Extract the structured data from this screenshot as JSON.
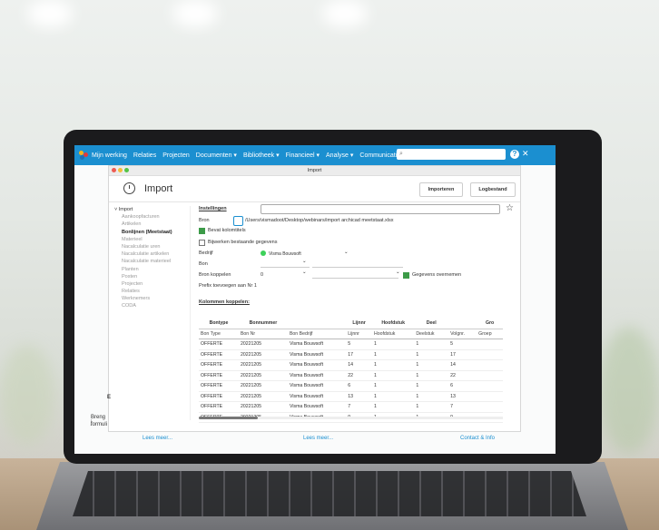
{
  "nav": {
    "items": [
      "Mijn werking",
      "Relaties",
      "Projecten",
      "Documenten ▾",
      "Bibliotheek ▾",
      "Financieel ▾",
      "Analyse ▾",
      "Communicatie ▾"
    ],
    "search_placeholder": "",
    "help": "?"
  },
  "window": {
    "title": "Import",
    "page_title": "Import",
    "import_button": "Importeren",
    "log_button": "Logbestand"
  },
  "sidebar": {
    "group": "Import",
    "items": [
      "Aankoopfacturen",
      "Artikelen",
      "Bonlijnen (Meetstaat)",
      "Materieel",
      "Nacalculatie uren",
      "Nacalculatie artikelen",
      "Nacalculatie materieel",
      "Planten",
      "Posten",
      "Projecten",
      "Relaties",
      "Werknemers",
      "CODA"
    ],
    "selected": "Bonlijnen (Meetstaat)"
  },
  "settings": {
    "heading": "Instellingen",
    "bron_label": "Bron",
    "bron_value": "/Users/vismadoot/Desktop/webinars/import archicad meetstaat.xlsx",
    "bevat_kolomtitels": "Bevat kolomtitels",
    "bijwerken": "Bijwerken bestaande gegevens",
    "bedrijf_label": "Bedrijf",
    "bedrijf_value": "Visma Bouwsoft",
    "bon_label": "Bon",
    "bron_koppelen_label": "Bron koppelen",
    "bron_koppelen_value": "0",
    "gegevens_overnemen": "Gegevens overnemen",
    "prefix": "Prefix toevoegen aan Nr 1",
    "kolommen": "Kolommen koppelen:"
  },
  "table": {
    "headers": [
      "Bontype",
      "Bonnummer",
      "",
      "Lijnnr",
      "Hoofdstuk",
      "Deel",
      "",
      "Gro"
    ],
    "subheaders": [
      "Bon Type",
      "Bon Nr",
      "Bon Bedrijf",
      "Lijnnr",
      "Hoofdstuk",
      "Deelstuk",
      "Volgnr.",
      "Groep"
    ],
    "rows": [
      [
        "OFFERTE",
        "20221205",
        "Visma Bouwsoft",
        "5",
        "1",
        "1",
        "5",
        ""
      ],
      [
        "OFFERTE",
        "20221205",
        "Visma Bouwsoft",
        "17",
        "1",
        "1",
        "17",
        ""
      ],
      [
        "OFFERTE",
        "20221205",
        "Visma Bouwsoft",
        "14",
        "1",
        "1",
        "14",
        ""
      ],
      [
        "OFFERTE",
        "20221205",
        "Visma Bouwsoft",
        "22",
        "1",
        "1",
        "22",
        ""
      ],
      [
        "OFFERTE",
        "20221205",
        "Visma Bouwsoft",
        "6",
        "1",
        "1",
        "6",
        ""
      ],
      [
        "OFFERTE",
        "20221205",
        "Visma Bouwsoft",
        "13",
        "1",
        "1",
        "13",
        ""
      ],
      [
        "OFFERTE",
        "20221205",
        "Visma Bouwsoft",
        "7",
        "1",
        "1",
        "7",
        ""
      ],
      [
        "OFFERTE",
        "20221205",
        "Visma Bouwsoft",
        "9",
        "1",
        "1",
        "9",
        ""
      ]
    ]
  },
  "footer": {
    "lees1": "Lees meer...",
    "lees2": "Lees meer...",
    "contact": "Contact & Info"
  },
  "peek": {
    "line1": "Breng j",
    "line2": "formuli",
    "letter": "E"
  },
  "colors": {
    "nav": "#1b8fd0",
    "check": "#3c9b48"
  }
}
